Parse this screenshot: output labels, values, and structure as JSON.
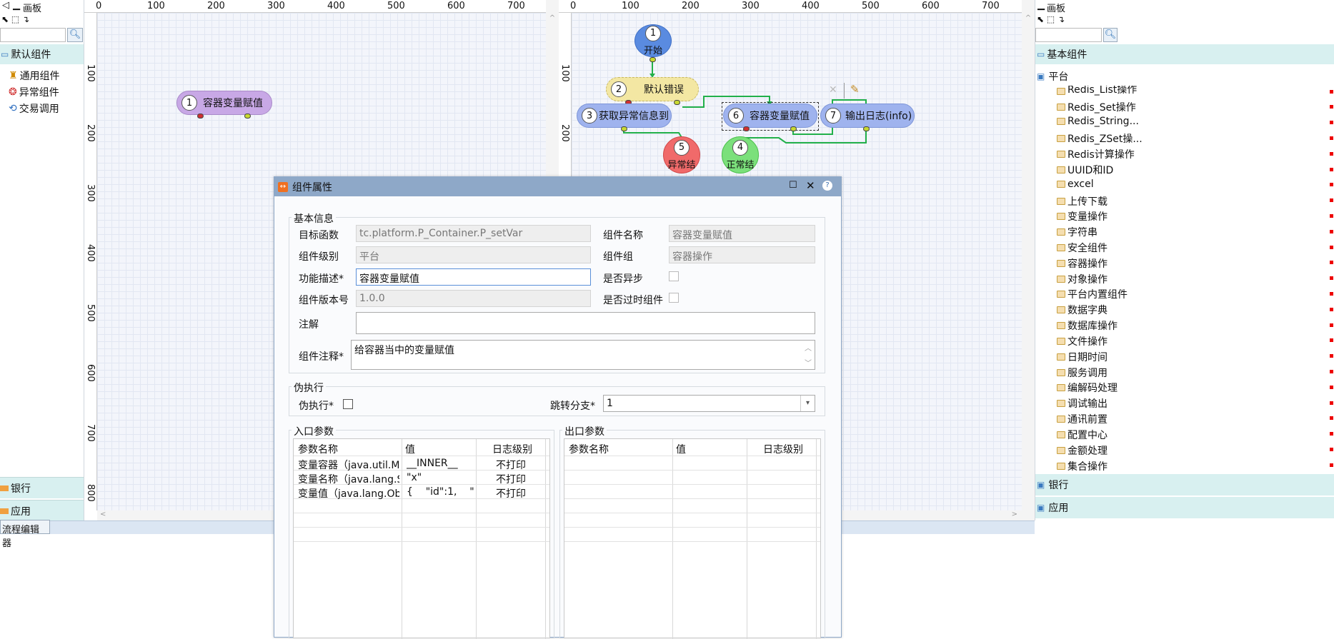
{
  "left_panel": {
    "title": "画板",
    "groups": {
      "default": "默认组件",
      "bank": "银行",
      "app": "应用"
    },
    "items": [
      "通用组件",
      "异常组件",
      "交易调用"
    ],
    "footer_tab": "流程编辑器"
  },
  "canvas_left": {
    "ruler_h": [
      "0",
      "100",
      "200",
      "300",
      "400",
      "500",
      "600",
      "700"
    ],
    "ruler_v": [
      "100",
      "200",
      "300",
      "400",
      "500",
      "600",
      "700",
      "800"
    ],
    "node": {
      "num": "1",
      "label": "容器变量赋值"
    }
  },
  "canvas_right": {
    "ruler_h": [
      "0",
      "100",
      "200",
      "300",
      "400",
      "500",
      "600",
      "700"
    ],
    "ruler_v": [
      "100",
      "200"
    ],
    "nodes": {
      "n1": {
        "num": "1",
        "label": "开始"
      },
      "n2": {
        "num": "2",
        "label": "默认错误"
      },
      "n3": {
        "num": "3",
        "label": "获取异常信息到"
      },
      "n6": {
        "num": "6",
        "label": "容器变量赋值"
      },
      "n7": {
        "num": "7",
        "label": "输出日志(info)"
      },
      "n5": {
        "num": "5",
        "label": "异常结"
      },
      "n4": {
        "num": "4",
        "label": "正常结"
      }
    }
  },
  "right_panel": {
    "title": "画板",
    "groups": {
      "basic": "基本组件",
      "platform": "平台",
      "bank": "银行",
      "app": "应用"
    },
    "items": [
      "Redis_List操作",
      "Redis_Set操作",
      "Redis_String...",
      "Redis_ZSet操...",
      "Redis计算操作",
      "UUID和ID",
      "excel",
      "上传下载",
      "变量操作",
      "字符串",
      "安全组件",
      "容器操作",
      "对象操作",
      "平台内置组件",
      "数据字典",
      "数据库操作",
      "文件操作",
      "日期时间",
      "服务调用",
      "编解码处理",
      "调试输出",
      "通讯前置",
      "配置中心",
      "金额处理",
      "集合操作"
    ]
  },
  "dialog": {
    "title": "组件属性",
    "basic": {
      "legend": "基本信息",
      "target_fn_label": "目标函数",
      "target_fn": "tc.platform.P_Container.P_setVar",
      "comp_name_label": "组件名称",
      "comp_name": "容器变量赋值",
      "level_label": "组件级别",
      "level": "平台",
      "group_label": "组件组",
      "group": "容器操作",
      "desc_label": "功能描述*",
      "desc": "容器变量赋值",
      "async_label": "是否异步",
      "version_label": "组件版本号",
      "version": "1.0.0",
      "deprecated_label": "是否过时组件",
      "note_label": "注解",
      "note": "",
      "comment_label": "组件注释*",
      "comment": "给容器当中的变量赋值"
    },
    "mock": {
      "legend": "伪执行",
      "exec_label": "伪执行*",
      "branch_label": "跳转分支*",
      "branch": "1"
    },
    "in_params": {
      "legend": "入口参数",
      "headers": [
        "参数名称",
        "值",
        "日志级别"
      ],
      "rows": [
        [
          "变量容器（java.util.M...",
          "__INNER__",
          "不打印"
        ],
        [
          "变量名称（java.lang.S...",
          "\"x\"",
          "不打印"
        ],
        [
          "变量值（java.lang.Obj...",
          "{    \"id\":1,    \"...",
          "不打印"
        ]
      ]
    },
    "out_params": {
      "legend": "出口参数",
      "headers": [
        "参数名称",
        "值",
        "日志级别"
      ]
    }
  },
  "colors": {
    "purple": "#c8a8e6",
    "blue": "#9fb3ee",
    "yellow": "#f3e7a3",
    "red": "#f06a6a",
    "green": "#7be07b",
    "header": "#8ea8c8"
  }
}
